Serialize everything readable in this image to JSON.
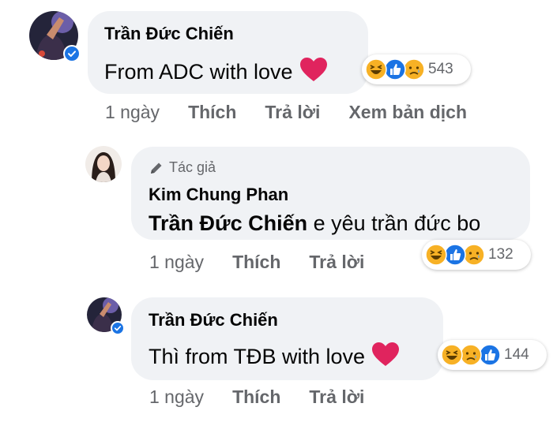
{
  "comments": [
    {
      "author": "Trần Đức Chiến",
      "text": "From ADC with love",
      "reactions_count": "543",
      "time": "1 ngày",
      "like_label": "Thích",
      "reply_label": "Trả lời",
      "translate_label": "Xem bản dịch"
    },
    {
      "badge": "Tác giả",
      "author": "Kim Chung Phan",
      "mention": "Trần Đức Chiến",
      "text": " e yêu trần đức bo",
      "reactions_count": "132",
      "time": "1 ngày",
      "like_label": "Thích",
      "reply_label": "Trả lời"
    },
    {
      "author": "Trần Đức Chiến",
      "text": "Thì from TĐB with love",
      "reactions_count": "144",
      "time": "1 ngày",
      "like_label": "Thích",
      "reply_label": "Trả lời"
    }
  ],
  "colors": {
    "bubble": "#f0f2f5",
    "meta_text": "#65676b",
    "verified_blue": "#1b74e4",
    "heart_red": "#e0245e",
    "haha_yellow": "#f7b125"
  },
  "icons": [
    "verified-badge-icon",
    "heart-emoji-icon",
    "haha-reaction-icon",
    "like-reaction-icon",
    "sad-reaction-icon",
    "pencil-icon"
  ]
}
